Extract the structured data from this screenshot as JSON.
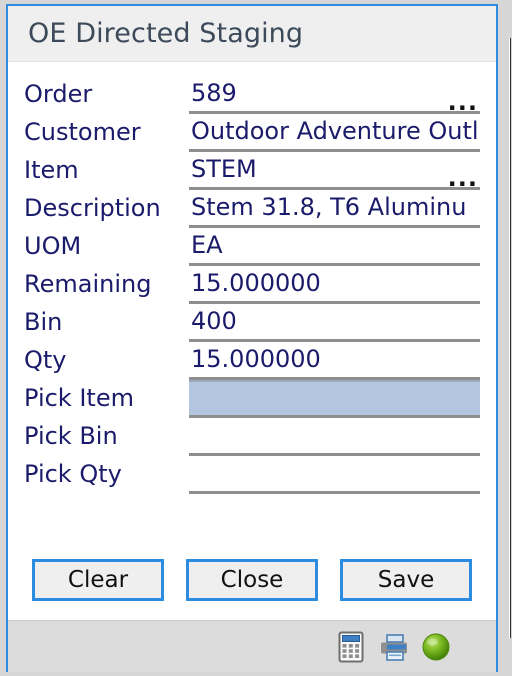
{
  "window": {
    "title": "OE Directed Staging"
  },
  "form": {
    "rows": [
      {
        "label": "Order",
        "value": "589",
        "lookup": "...",
        "has_lookup": true,
        "focused": false
      },
      {
        "label": "Customer",
        "value": "Outdoor Adventure Outl",
        "lookup": "",
        "has_lookup": false,
        "focused": false
      },
      {
        "label": "Item",
        "value": "STEM",
        "lookup": "...",
        "has_lookup": true,
        "focused": false
      },
      {
        "label": "Description",
        "value": "Stem 31.8, T6 Aluminu",
        "lookup": "",
        "has_lookup": false,
        "focused": false
      },
      {
        "label": "UOM",
        "value": "EA",
        "lookup": "",
        "has_lookup": false,
        "focused": false
      },
      {
        "label": "Remaining",
        "value": "15.000000",
        "lookup": "",
        "has_lookup": false,
        "focused": false
      },
      {
        "label": "Bin",
        "value": "400",
        "lookup": "",
        "has_lookup": false,
        "focused": false
      },
      {
        "label": "Qty",
        "value": "15.000000",
        "lookup": "",
        "has_lookup": false,
        "focused": false
      },
      {
        "label": "Pick Item",
        "value": "",
        "lookup": "",
        "has_lookup": false,
        "focused": true
      },
      {
        "label": "Pick Bin",
        "value": "",
        "lookup": "",
        "has_lookup": false,
        "focused": false
      },
      {
        "label": "Pick Qty",
        "value": "",
        "lookup": "",
        "has_lookup": false,
        "focused": false
      }
    ]
  },
  "buttons": {
    "clear_label": "Clear",
    "close_label": "Close",
    "save_label": "Save"
  },
  "statusbar": {
    "icons": [
      {
        "name": "calculator-icon",
        "title": "Calculator"
      },
      {
        "name": "printer-icon",
        "title": "Print"
      },
      {
        "name": "status-light-icon",
        "title": "Connected"
      }
    ]
  },
  "colors": {
    "accent_blue": "#2d8ce0",
    "field_focus": "#b2c6e0",
    "label_text": "#1b1b6b",
    "title_text": "#3c4a5a",
    "titlebar_bg": "#efefef",
    "statusbar_bg": "#dcdcdc",
    "status_green": "#57a513"
  }
}
